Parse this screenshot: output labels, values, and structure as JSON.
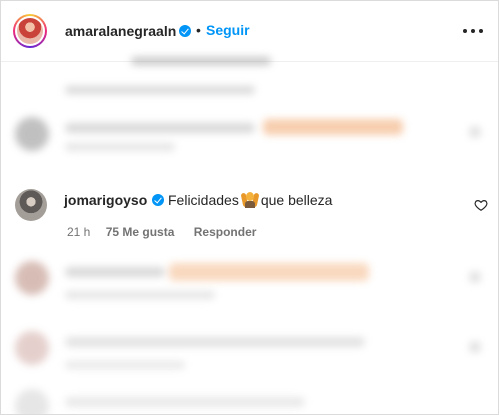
{
  "header": {
    "username": "amaralanegraaln",
    "separator": "•",
    "follow_label": "Seguir"
  },
  "comment": {
    "username": "jomarigoyso",
    "text_before": "Felicidades",
    "text_after": "que belleza",
    "emoji": "person-with-raised-hands",
    "time": "21 h",
    "likes": "75 Me gusta",
    "reply_label": "Responder"
  },
  "colors": {
    "accent": "#0095f6",
    "text": "#262626",
    "secondary": "#737373"
  },
  "icons": {
    "more": "more-options-icon",
    "verified": "verified-badge-icon",
    "heart": "heart-outline-icon"
  }
}
